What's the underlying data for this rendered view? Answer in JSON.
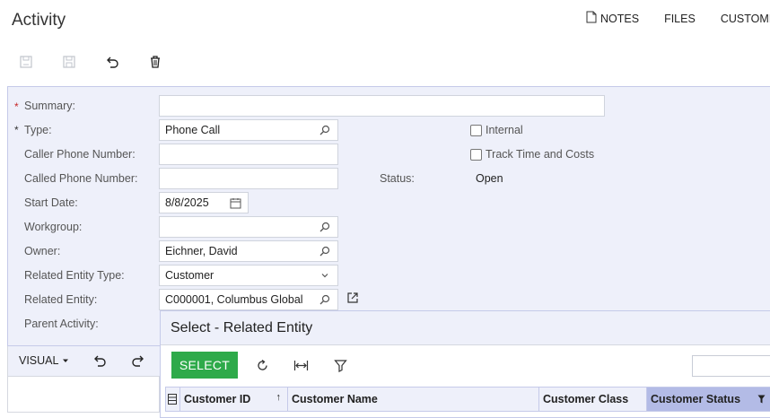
{
  "header": {
    "title": "Activity"
  },
  "toplinks": {
    "notes": "NOTES",
    "files": "FILES",
    "customize": "CUSTOMI"
  },
  "form": {
    "summary": {
      "label": "Summary:",
      "value": ""
    },
    "type": {
      "label": "Type:",
      "value": "Phone Call"
    },
    "caller_phone": {
      "label": "Caller Phone Number:",
      "value": ""
    },
    "called_phone": {
      "label": "Called Phone Number:",
      "value": ""
    },
    "start_date": {
      "label": "Start Date:",
      "value": "8/8/2025"
    },
    "workgroup": {
      "label": "Workgroup:",
      "value": ""
    },
    "owner": {
      "label": "Owner:",
      "value": "Eichner, David"
    },
    "related_entity_type": {
      "label": "Related Entity Type:",
      "value": "Customer"
    },
    "related_entity": {
      "label": "Related Entity:",
      "value": "C000001, Columbus Global"
    },
    "parent_activity": {
      "label": "Parent Activity:"
    },
    "internal": {
      "label": "Internal",
      "checked": false
    },
    "track_time": {
      "label": "Track Time and Costs",
      "checked": false
    },
    "status": {
      "label": "Status:",
      "value": "Open"
    },
    "required_marker": "*"
  },
  "editor": {
    "visual_label": "VISUAL"
  },
  "popup": {
    "title": "Select - Related Entity",
    "select_label": "SELECT",
    "search_value": "",
    "columns": [
      {
        "label": "Customer ID",
        "sorted": "asc"
      },
      {
        "label": "Customer Name"
      },
      {
        "label": "Customer Class"
      },
      {
        "label": "Customer Status",
        "filtered": true
      }
    ]
  },
  "colors": {
    "accent": "#2eaa4a",
    "panel_bg": "#eef0fa",
    "selected_col": "#b3bbe6",
    "required": "#c62828"
  }
}
